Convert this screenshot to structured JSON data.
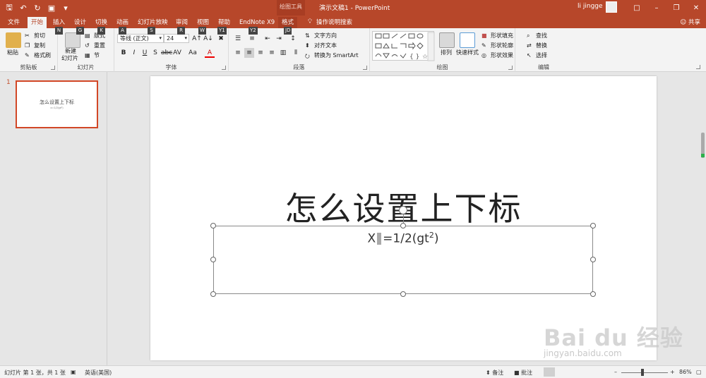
{
  "titlebar": {
    "context_tools": "绘图工具",
    "doc_title": "演示文稿1  -  PowerPoint",
    "user": "li jingge"
  },
  "tabs": [
    "文件",
    "开始",
    "插入",
    "设计",
    "切换",
    "动画",
    "幻灯片放映",
    "审阅",
    "视图",
    "帮助",
    "EndNote X9",
    "格式"
  ],
  "tellme": "操作说明搜索",
  "share": "共享",
  "keytips": [
    "N",
    "G",
    "K",
    "A",
    "S",
    "R",
    "W",
    "Y1",
    "Y2",
    "JD"
  ],
  "ribbon": {
    "clipboard": {
      "label": "剪贴板",
      "paste": "粘贴",
      "cut": "剪切",
      "copy": "复制",
      "painter": "格式刷"
    },
    "slides": {
      "label": "幻灯片",
      "new_slide": "新建",
      "new_slide2": "幻灯片",
      "layout": "版式",
      "reset": "重置",
      "section": "节"
    },
    "font": {
      "label": "字体",
      "font_name": "等线 (正文)",
      "font_size": "24",
      "aa": "Aa"
    },
    "paragraph": {
      "label": "段落",
      "text_direction": "文字方向",
      "align_text": "对齐文本",
      "smartart": "转换为 SmartArt"
    },
    "drawing": {
      "label": "绘图",
      "arrange": "排列",
      "quick_styles": "快速样式",
      "fill": "形状填充",
      "outline": "形状轮廓",
      "effects": "形状效果"
    },
    "editing": {
      "label": "编辑",
      "find": "查找",
      "replace": "替换",
      "select": "选择"
    }
  },
  "thumbnail": {
    "number": "1",
    "title": "怎么设置上下标",
    "subtitle": "x=1/2(gt²)"
  },
  "slide": {
    "title": "怎么设置上下标",
    "formula_x": "X",
    "formula_rest": "=1/2(gt",
    "formula_sup": "2",
    "formula_close": ")"
  },
  "status": {
    "slide_info": "幻灯片 第 1 张，共 1 张",
    "language": "英语(美国)",
    "notes": "备注",
    "comments": "批注",
    "zoom": "86%"
  },
  "watermark": {
    "brand": "Bai du 经验",
    "url": "jingyan.baidu.com"
  },
  "colors": {
    "accent": "#b7472a",
    "selection": "#d24726"
  }
}
